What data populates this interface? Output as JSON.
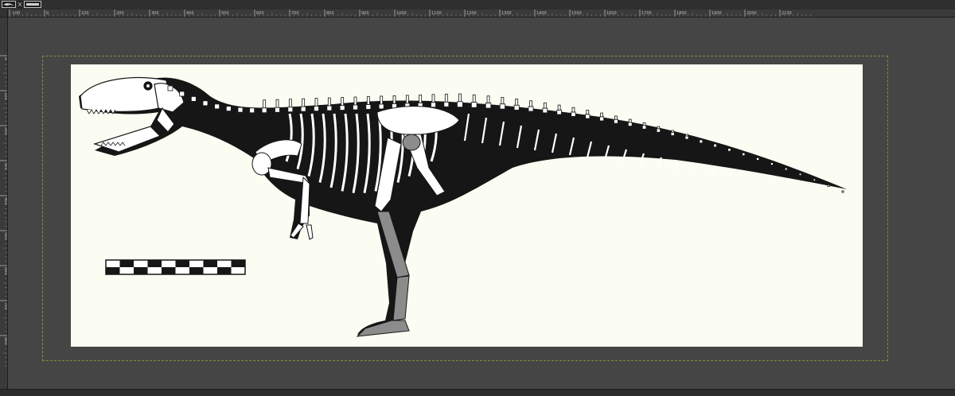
{
  "window": {
    "tabs": [
      {
        "name": "image-tab-1"
      },
      {
        "name": "image-tab-2"
      }
    ]
  },
  "ruler": {
    "h_labels": [
      "-100",
      "0",
      "100",
      "200",
      "300",
      "400",
      "500",
      "600",
      "700",
      "800",
      "900",
      "1000",
      "1100",
      "1200",
      "1300",
      "1400",
      "1500",
      "1600",
      "1700",
      "1800",
      "1900",
      "2000",
      "2100"
    ],
    "v_labels": [
      "0",
      "100",
      "200",
      "300",
      "400",
      "500",
      "600",
      "700",
      "800"
    ]
  },
  "colors": {
    "workspace": "#454545",
    "canvas_bg": "#fbfdf2",
    "silhouette": "#161616",
    "bone": "#ffffff",
    "bone_grey": "#8c8c8c",
    "layer_boundary": "#8a8a3a"
  },
  "image": {
    "subject": "theropod-skeletal-diagram"
  }
}
